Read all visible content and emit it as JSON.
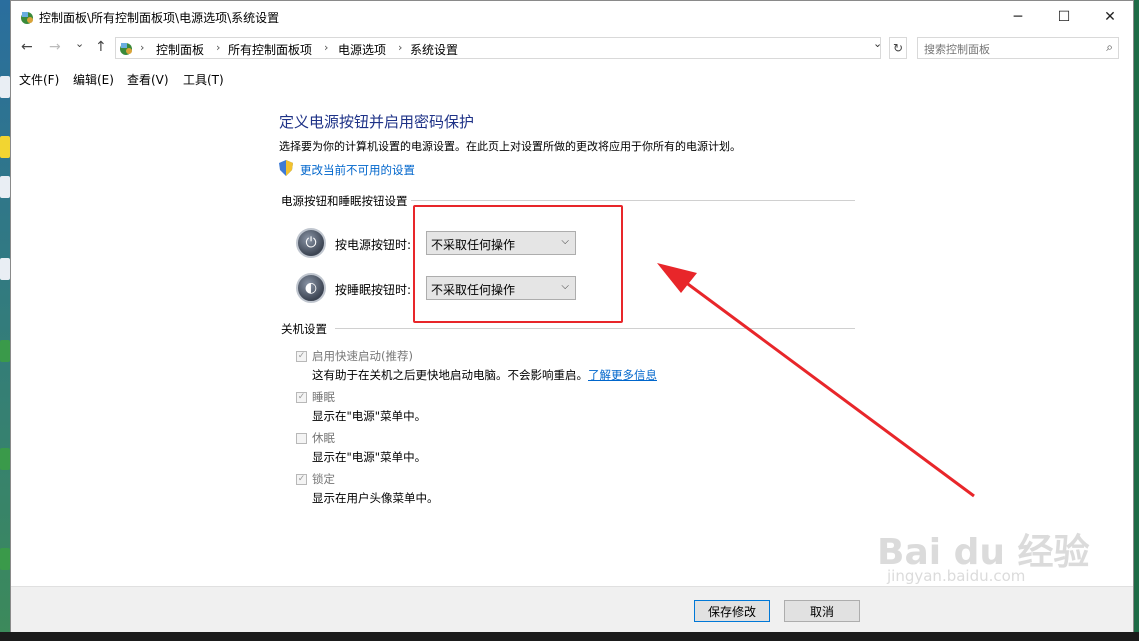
{
  "window": {
    "title": "控制面板\\所有控制面板项\\电源选项\\系统设置",
    "controls": {
      "minimize": "─",
      "maximize": "☐",
      "close": "✕"
    }
  },
  "nav": {
    "back": "←",
    "forward": "→",
    "dropdown": "⌄",
    "up": "↑",
    "refresh": "↻",
    "breadcrumb": [
      "控制面板",
      "所有控制面板项",
      "电源选项",
      "系统设置"
    ],
    "separator": "›"
  },
  "search": {
    "placeholder": "搜索控制面板"
  },
  "menu": [
    "文件(F)",
    "编辑(E)",
    "查看(V)",
    "工具(T)"
  ],
  "page": {
    "heading": "定义电源按钮并启用密码保护",
    "description": "选择要为你的计算机设置的电源设置。在此页上对设置所做的更改将应用于你所有的电源计划。",
    "change_link": "更改当前不可用的设置"
  },
  "power_section": {
    "title": "电源按钮和睡眠按钮设置",
    "rows": [
      {
        "label": "按电源按钮时:",
        "value": "不采取任何操作",
        "icon": "power-icon"
      },
      {
        "label": "按睡眠按钮时:",
        "value": "不采取任何操作",
        "icon": "sleep-icon"
      }
    ]
  },
  "shutdown_section": {
    "title": "关机设置",
    "items": [
      {
        "label": "启用快速启动(推荐)",
        "checked": true,
        "desc": "这有助于在关机之后更快地启动电脑。不会影响重启。",
        "link": "了解更多信息"
      },
      {
        "label": "睡眠",
        "checked": true,
        "desc": "显示在\"电源\"菜单中。"
      },
      {
        "label": "休眠",
        "checked": false,
        "desc": "显示在\"电源\"菜单中。"
      },
      {
        "label": "锁定",
        "checked": true,
        "desc": "显示在用户头像菜单中。"
      }
    ]
  },
  "footer": {
    "save": "保存修改",
    "cancel": "取消"
  },
  "watermark": {
    "main": "Bai du 经验",
    "sub": "jingyan.baidu.com"
  },
  "colors": {
    "heading": "#1e3287",
    "link": "#0066cc",
    "annotation": "#e8262a"
  }
}
